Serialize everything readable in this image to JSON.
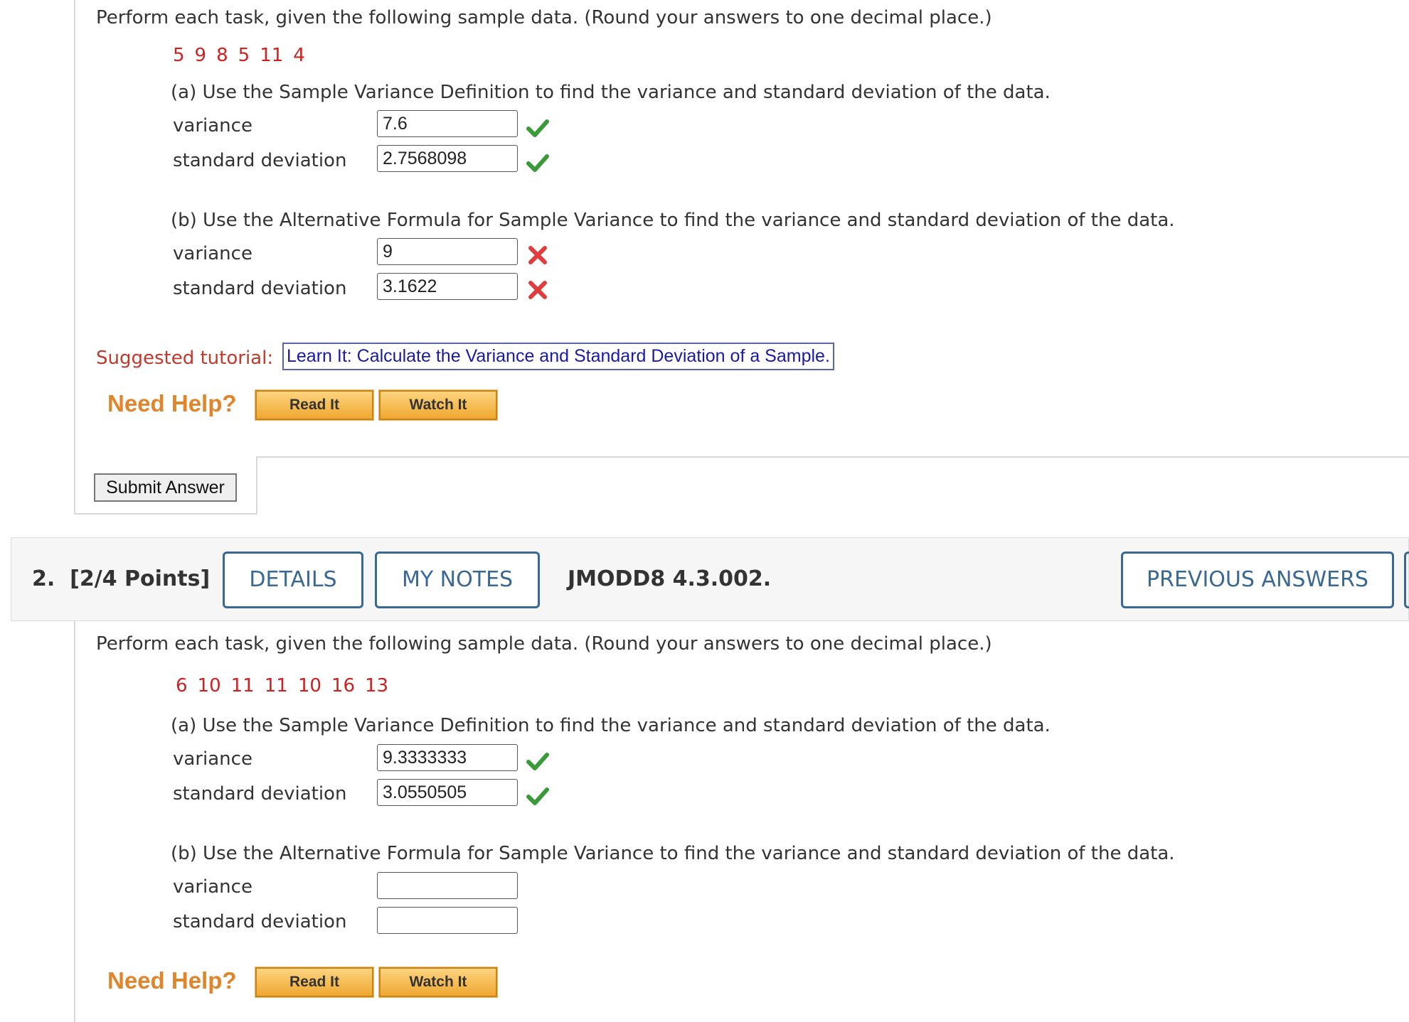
{
  "q1": {
    "instruction": "Perform each task, given the following sample data. (Round your answers to one decimal place.)",
    "data": [
      "5",
      "9",
      "8",
      "5",
      "11",
      "4"
    ],
    "part_a": {
      "question": "(a) Use the Sample Variance Definition to find the variance and standard deviation of the data.",
      "variance_label": "variance",
      "variance_value": "7.6",
      "variance_status": "correct",
      "stddev_label": "standard deviation",
      "stddev_value": "2.7568098",
      "stddev_status": "correct"
    },
    "part_b": {
      "question": "(b) Use the Alternative Formula for Sample Variance to find the variance and standard deviation of the data.",
      "variance_label": "variance",
      "variance_value": "9",
      "variance_status": "incorrect",
      "stddev_label": "standard deviation",
      "stddev_value": "3.1622",
      "stddev_status": "incorrect"
    },
    "suggested_label": "Suggested tutorial:",
    "tutorial_link": "Learn It: Calculate the Variance and Standard Deviation of a Sample.",
    "need_help": "Need Help?",
    "read_it": "Read It",
    "watch_it": "Watch It",
    "submit": "Submit Answer"
  },
  "q2_header": {
    "number": "2.",
    "points": "[2/4 Points]",
    "details": "DETAILS",
    "my_notes": "MY NOTES",
    "ref": "JMODD8 4.3.002.",
    "previous_answers": "PREVIOUS ANSWERS"
  },
  "q2": {
    "instruction": "Perform each task, given the following sample data. (Round your answers to one decimal place.)",
    "data": [
      "6",
      "10",
      "11",
      "11",
      "10",
      "16",
      "13"
    ],
    "part_a": {
      "question": "(a) Use the Sample Variance Definition to find the variance and standard deviation of the data.",
      "variance_label": "variance",
      "variance_value": "9.3333333",
      "variance_status": "correct",
      "stddev_label": "standard deviation",
      "stddev_value": "3.0550505",
      "stddev_status": "correct"
    },
    "part_b": {
      "question": "(b) Use the Alternative Formula for Sample Variance to find the variance and standard deviation of the data.",
      "variance_label": "variance",
      "variance_value": "",
      "stddev_label": "standard deviation",
      "stddev_value": ""
    },
    "need_help": "Need Help?",
    "read_it": "Read It",
    "watch_it": "Watch It"
  },
  "colors": {
    "data_red": "#cc2222",
    "correct_green": "#3a9a3a",
    "incorrect_red": "#e03c3c",
    "link_blue": "#1a1aa6",
    "tab_blue": "#3a6894",
    "help_orange": "#e0852a"
  },
  "icons": {
    "correct": "check-icon",
    "incorrect": "cross-icon"
  }
}
